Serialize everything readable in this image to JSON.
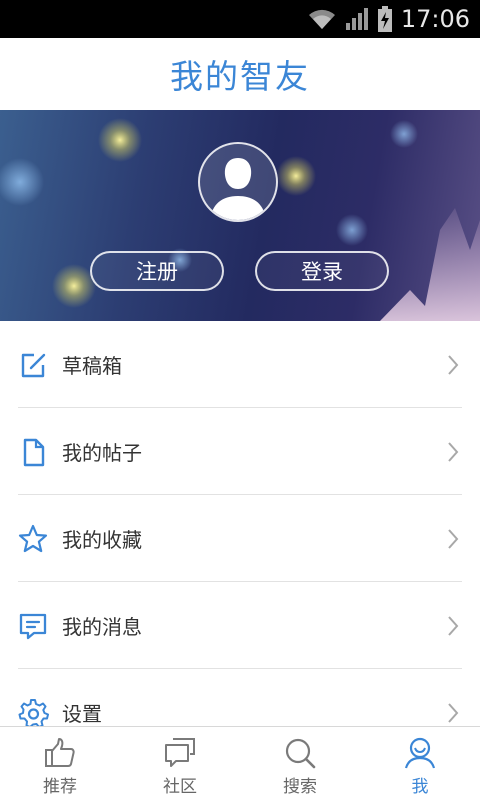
{
  "status_bar": {
    "time": "17:06"
  },
  "header": {
    "title": "我的智友"
  },
  "profile": {
    "register_label": "注册",
    "login_label": "登录"
  },
  "menu": [
    {
      "label": "草稿箱",
      "icon": "edit-icon"
    },
    {
      "label": "我的帖子",
      "icon": "document-icon"
    },
    {
      "label": "我的收藏",
      "icon": "star-icon"
    },
    {
      "label": "我的消息",
      "icon": "message-icon"
    },
    {
      "label": "设置",
      "icon": "gear-icon"
    }
  ],
  "tabs": [
    {
      "label": "推荐",
      "icon": "thumbs-up-icon",
      "active": false
    },
    {
      "label": "社区",
      "icon": "chat-bubbles-icon",
      "active": false
    },
    {
      "label": "搜索",
      "icon": "search-icon",
      "active": false
    },
    {
      "label": "我",
      "icon": "user-icon",
      "active": true
    }
  ],
  "colors": {
    "accent": "#3b86d6",
    "text": "#333333",
    "tab_inactive": "#666666",
    "status_bar": "#000000"
  }
}
